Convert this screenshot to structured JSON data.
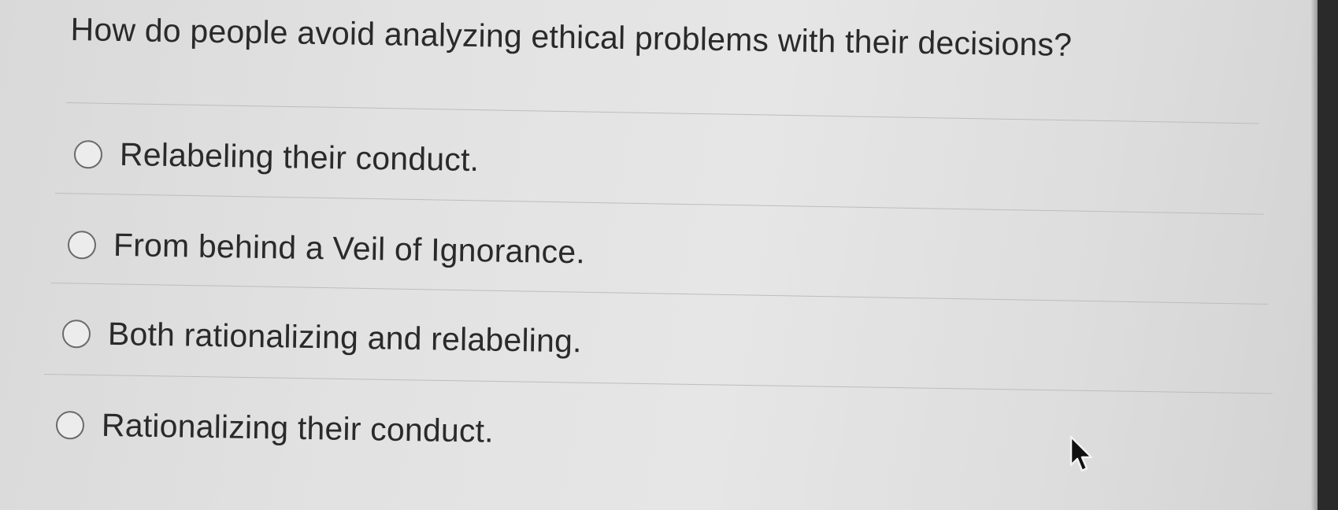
{
  "question": {
    "text": "How do people avoid analyzing ethical problems with their decisions?"
  },
  "options": [
    {
      "label": "Relabeling their conduct.",
      "selected": false
    },
    {
      "label": "From behind a Veil of Ignorance.",
      "selected": false
    },
    {
      "label": "Both rationalizing and relabeling.",
      "selected": false
    },
    {
      "label": "Rationalizing their conduct.",
      "selected": false
    }
  ],
  "icons": {
    "cursor": "mouse-pointer-icon",
    "radio": "radio-button-empty"
  }
}
